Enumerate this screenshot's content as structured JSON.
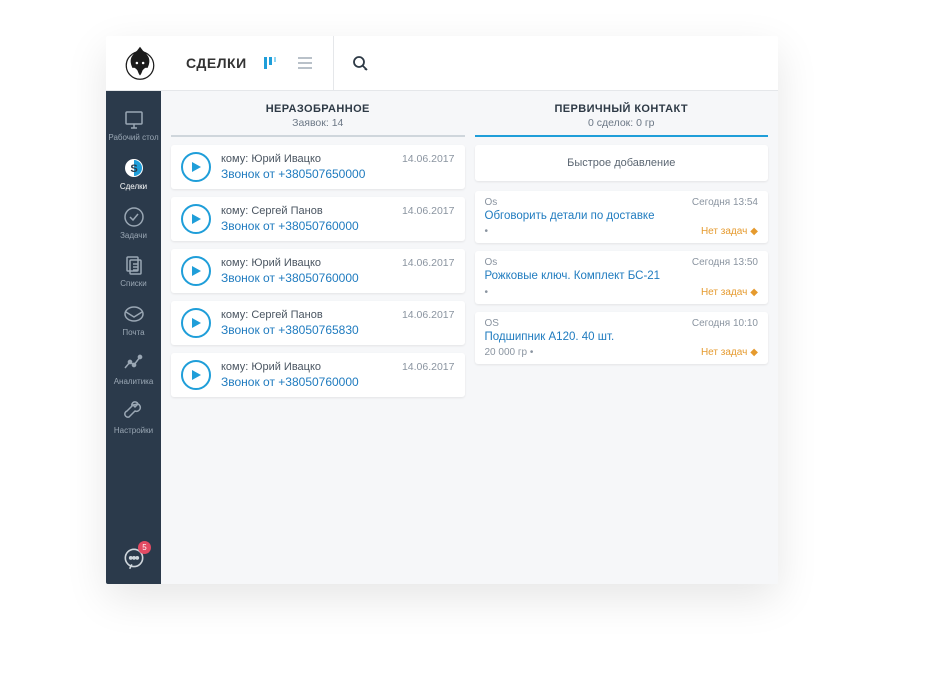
{
  "header": {
    "title": "СДЕЛКИ"
  },
  "sidebar": {
    "items": [
      {
        "label": "Рабочий стол"
      },
      {
        "label": "Сделки"
      },
      {
        "label": "Задачи"
      },
      {
        "label": "Списки"
      },
      {
        "label": "Почта"
      },
      {
        "label": "Аналитика"
      },
      {
        "label": "Настройки"
      }
    ],
    "chat_badge": "5"
  },
  "columns": {
    "unsorted": {
      "title": "НЕРАЗОБРАННОЕ",
      "subtitle": "Заявок: 14",
      "cards": [
        {
          "to": "кому: Юрий Ивацко",
          "date": "14.06.2017",
          "link": "Звонок от +380507650000"
        },
        {
          "to": "кому: Сергей Панов",
          "date": "14.06.2017",
          "link": "Звонок от +38050760000"
        },
        {
          "to": "кому: Юрий Ивацко",
          "date": "14.06.2017",
          "link": "Звонок от +38050760000"
        },
        {
          "to": "кому: Сергей Панов",
          "date": "14.06.2017",
          "link": "Звонок от +38050765830"
        },
        {
          "to": "кому: Юрий Ивацко",
          "date": "14.06.2017",
          "link": "Звонок от +38050760000"
        }
      ]
    },
    "primary": {
      "title": "ПЕРВИЧНЫЙ КОНТАКТ",
      "subtitle": "0 сделок: 0 гр",
      "quick_add": "Быстрое добавление",
      "cards": [
        {
          "owner": "Os",
          "time": "Сегодня 13:54",
          "title": "Обговорить детали по доставке",
          "price": "•",
          "tasks": "Нет задач"
        },
        {
          "owner": "Os",
          "time": "Сегодня 13:50",
          "title": "Рожковые ключ. Комплект БС-21",
          "price": "•",
          "tasks": "Нет задач"
        },
        {
          "owner": "OS",
          "time": "Сегодня 10:10",
          "title": "Подшипник А120. 40 шт.",
          "price": "20 000 гр •",
          "tasks": "Нет задач"
        }
      ]
    }
  }
}
